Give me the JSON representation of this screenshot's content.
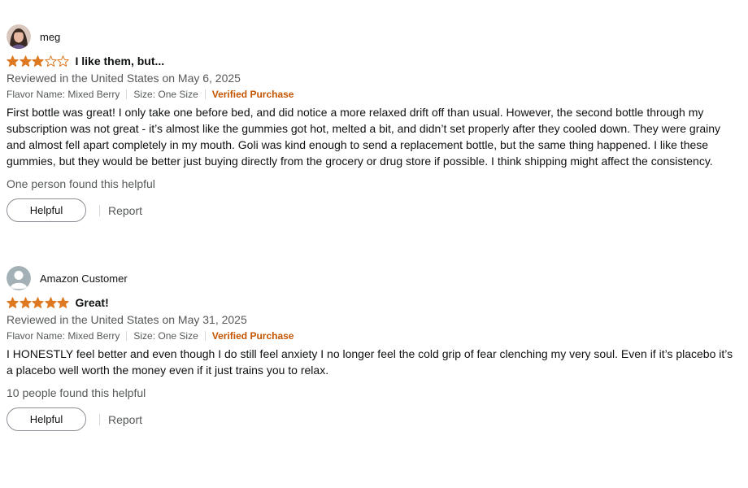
{
  "reviews": [
    {
      "profile_name": "meg",
      "avatar": "photo-avatar",
      "rating": 3,
      "max_rating": 5,
      "title": "I like them, but...",
      "date": "Reviewed in the United States on May 6, 2025",
      "flavor": "Flavor Name: Mixed Berry",
      "size": "Size: One Size",
      "verified": "Verified Purchase",
      "body": "First bottle was great! I only take one before bed, and did notice a more relaxed drift off than usual. However, the second bottle through my subscription was not great - it’s almost like the gummies got hot, melted a bit, and didn’t set properly after they cooled down. They were grainy and almost fell apart completely in my mouth. Goli was kind enough to send a replacement bottle, but the same thing happened. I like these gummies, but they would be better just buying directly from the grocery or drug store if possible. I think shipping might affect the consistency.",
      "helpful_text": "One person found this helpful",
      "helpful_label": "Helpful",
      "report_label": "Report"
    },
    {
      "profile_name": "Amazon Customer",
      "avatar": "default-user-icon",
      "rating": 5,
      "max_rating": 5,
      "title": "Great!",
      "date": "Reviewed in the United States on May 31, 2025",
      "flavor": "Flavor Name: Mixed Berry",
      "size": "Size: One Size",
      "verified": "Verified Purchase",
      "body": "I HONESTLY feel better and even though I do still feel anxiety I no longer feel the cold grip of fear clenching my very soul. Even if it’s placebo it’s a placebo well worth the money even if it just trains you to relax.",
      "helpful_text": "10 people found this helpful",
      "helpful_label": "Helpful",
      "report_label": "Report"
    }
  ],
  "colors": {
    "star_fill": "#de7921",
    "verified": "#c45500",
    "muted_text": "#565959",
    "text": "#0f1111"
  }
}
